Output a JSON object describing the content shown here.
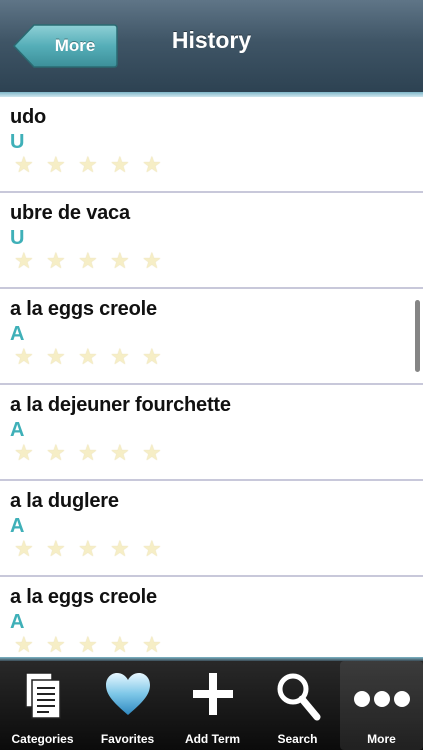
{
  "navbar": {
    "back_label": "More",
    "title": "History"
  },
  "items": [
    {
      "term": "udo",
      "letter": "U"
    },
    {
      "term": "ubre de vaca",
      "letter": "U"
    },
    {
      "term": "a la eggs creole",
      "letter": "A"
    },
    {
      "term": "a la dejeuner fourchette",
      "letter": "A"
    },
    {
      "term": "a la duglere",
      "letter": "A"
    },
    {
      "term": "a la eggs creole",
      "letter": "A"
    }
  ],
  "star_glyph": "★",
  "tabs": [
    {
      "label": "Categories",
      "icon": "document-icon"
    },
    {
      "label": "Favorites",
      "icon": "heart-icon"
    },
    {
      "label": "Add Term",
      "icon": "plus-icon"
    },
    {
      "label": "Search",
      "icon": "search-icon"
    },
    {
      "label": "More",
      "icon": "more-icon"
    }
  ],
  "colors": {
    "accent": "#3fb0b8",
    "navbar": "#3f5566",
    "star": "#f6eec6"
  }
}
